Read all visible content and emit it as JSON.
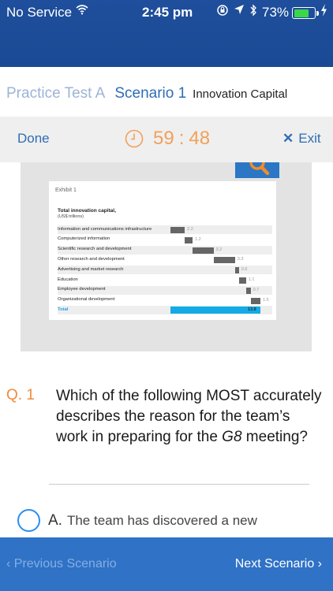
{
  "status_bar": {
    "carrier": "No Service",
    "time": "2:45 pm",
    "battery_pct": "73%",
    "battery_level": 0.73,
    "icons": [
      "wifi-icon",
      "orientation-lock-icon",
      "location-icon",
      "bluetooth-icon",
      "battery-icon",
      "charging-icon"
    ]
  },
  "breadcrumb": {
    "test": "Practice Test A",
    "scenario": "Scenario 1",
    "topic": "Innovation Capital"
  },
  "toolbar": {
    "done": "Done",
    "timer_minutes": "59",
    "timer_sep": ":",
    "timer_seconds": "48",
    "exit": "Exit"
  },
  "exhibit": {
    "label": "Exhibit 1",
    "title": "Total innovation capital,",
    "subtitle": "(US$ trillions)",
    "rows": [
      {
        "label": "Information and communications infrastructure",
        "value": "2.2",
        "start": 0.0,
        "amount": 2.2
      },
      {
        "label": "Computerized information",
        "value": "1.2",
        "start": 2.2,
        "amount": 1.2
      },
      {
        "label": "Scientific research and development",
        "value": "3.2",
        "start": 3.4,
        "amount": 3.2
      },
      {
        "label": "Other research and development",
        "value": "3.3",
        "start": 6.6,
        "amount": 3.3
      },
      {
        "label": "Advertising and market research",
        "value": "0.6",
        "start": 9.9,
        "amount": 0.6
      },
      {
        "label": "Education",
        "value": "1.1",
        "start": 10.5,
        "amount": 1.1
      },
      {
        "label": "Employee development",
        "value": "0.7",
        "start": 11.6,
        "amount": 0.7
      },
      {
        "label": "Organizational development",
        "value": "1.5",
        "start": 12.3,
        "amount": 1.5
      }
    ],
    "total": {
      "label": "Total",
      "value": "13.8",
      "amount": 13.8
    }
  },
  "question": {
    "number": "Q. 1",
    "text_before": "Which of the following MOST accurately describes the reason for the team’s work in preparing for the ",
    "text_italic": "G8",
    "text_after": " meeting?"
  },
  "options": [
    {
      "letter": "A.",
      "text": "The team has discovered a new"
    }
  ],
  "navigation": {
    "prev": "‹ Previous Scenario",
    "next": "Next Scenario ›"
  },
  "colors": {
    "header": "#1f4f9c",
    "accent_blue": "#2f6db5",
    "timer_orange": "#f3a05a",
    "question_orange": "#f08a3c",
    "bottom_bar": "#2f72c6",
    "total_bar": "#14aae6"
  }
}
